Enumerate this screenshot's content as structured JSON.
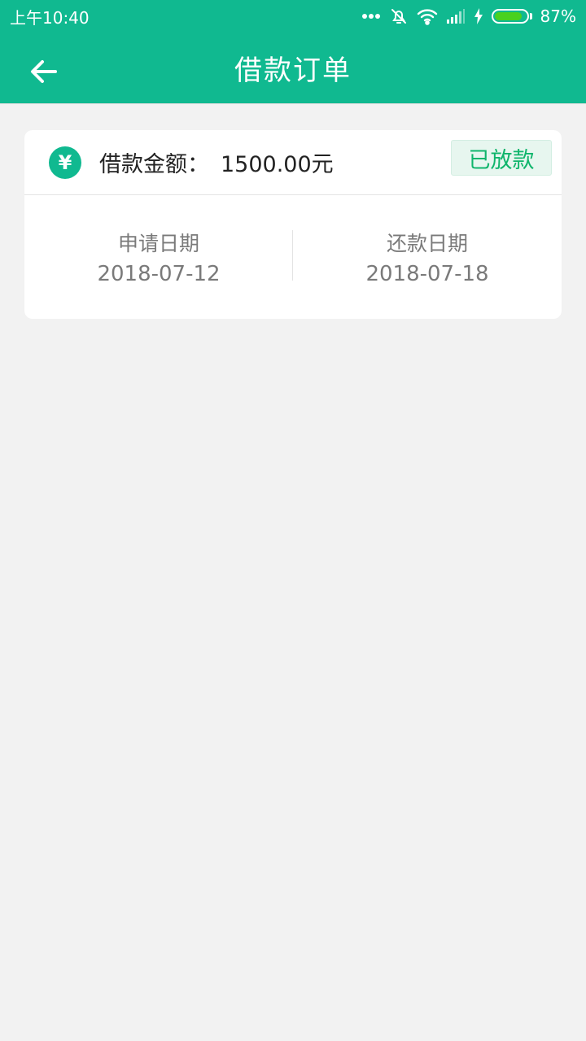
{
  "status_bar": {
    "time": "上午10:40",
    "battery_percent": "87%",
    "battery_level": 0.87,
    "icons": [
      "more-dots-icon",
      "bell-off-icon",
      "wifi-icon",
      "signal-icon",
      "charging-icon",
      "battery-icon"
    ]
  },
  "header": {
    "title": "借款订单",
    "back_icon": "arrow-left-icon"
  },
  "order": {
    "amount_label": "借款金额：",
    "amount_value": "1500.00元",
    "currency_icon": "yen-icon",
    "status": "已放款",
    "apply_date_label": "申请日期",
    "apply_date": "2018-07-12",
    "repay_date_label": "还款日期",
    "repay_date": "2018-07-18"
  },
  "colors": {
    "primary": "#10b990",
    "status_text": "#10b56c",
    "status_bg": "#e7f6ef",
    "page_bg": "#f2f2f2"
  }
}
